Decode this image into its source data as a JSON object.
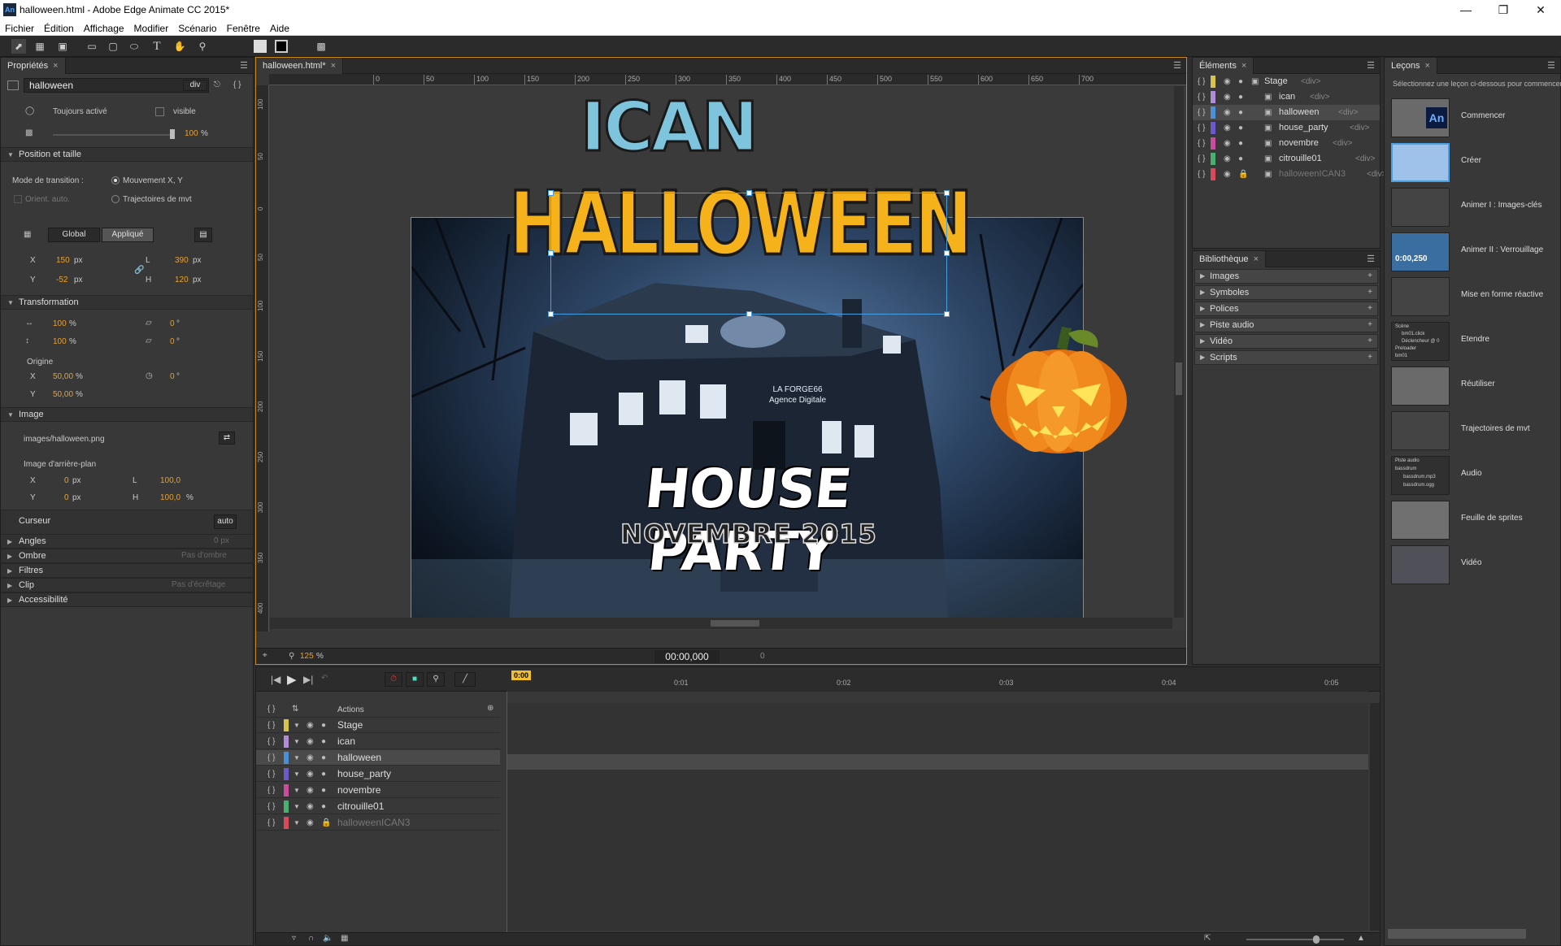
{
  "window": {
    "app_icon": "An",
    "title": "halloween.html - Adobe Edge Animate CC 2015*"
  },
  "menu": [
    "Fichier",
    "Édition",
    "Affichage",
    "Modifier",
    "Scénario",
    "Fenêtre",
    "Aide"
  ],
  "properties": {
    "tab": "Propriétés",
    "element_name": "halloween",
    "element_type": "div",
    "always_active": "Toujours activé",
    "visible": "visible",
    "opacity": "100",
    "opacity_unit": "%",
    "sec_position": "Position et taille",
    "transition_mode": "Mode de transition :",
    "mode_xy": "Mouvement X, Y",
    "orient_auto": "Orient. auto.",
    "motion_paths": "Trajectoires de mvt",
    "tab_global": "Global",
    "tab_applied": "Appliqué",
    "x_label": "X",
    "x_val": "150",
    "y_label": "Y",
    "y_val": "-52",
    "w_label": "L",
    "w_val": "390",
    "h_label": "H",
    "h_val": "120",
    "px": "px",
    "sec_transform": "Transformation",
    "scale_x": "100",
    "scale_y": "100",
    "skew_x": "0",
    "skew_y": "0",
    "deg": "°",
    "origin_label": "Origine",
    "origin_x": "50,00",
    "origin_y": "50,00",
    "rotation": "0",
    "sec_image": "Image",
    "image_path": "images/halloween.png",
    "bg_image_label": "Image d'arrière-plan",
    "bg_x": "0",
    "bg_y": "0",
    "bg_w": "100,0",
    "bg_h": "100,0",
    "cursor_label": "Curseur",
    "cursor_val": "auto",
    "angles": "Angles",
    "angles_val": "0 px",
    "shadow": "Ombre",
    "shadow_val": "Pas d'ombre",
    "filters": "Filtres",
    "clip": "Clip",
    "clip_val": "Pas d'écrêtage",
    "accessibility": "Accessibilité"
  },
  "stage": {
    "tab": "halloween.html*",
    "ruler_h": [
      "0",
      "50",
      "100",
      "150",
      "200",
      "250",
      "300",
      "350",
      "400",
      "450",
      "500",
      "550",
      "600",
      "650",
      "700"
    ],
    "ruler_v": [
      "100",
      "50",
      "0",
      "50",
      "100",
      "150",
      "200",
      "250",
      "300",
      "350",
      "400"
    ],
    "art_title1": "ICAN",
    "art_title2": "HALLOWEEN",
    "house_sign1": "LA FORGE66",
    "house_sign2": "Agence Digitale",
    "party_title": "HOUSE PARTY",
    "party_date": "NOVEMBRE 2015",
    "zoom": "125",
    "zoom_unit": "%",
    "time": "00:00,000",
    "time2": "0"
  },
  "elements_panel": {
    "tab": "Éléments",
    "items": [
      {
        "name": "Stage",
        "tag": "<div>",
        "color": "#d9c24a"
      },
      {
        "name": "ican",
        "tag": "<div>",
        "color": "#b08bd8"
      },
      {
        "name": "halloween",
        "tag": "<div>",
        "color": "#4a90d9"
      },
      {
        "name": "house_party",
        "tag": "<div>",
        "color": "#6a5acd"
      },
      {
        "name": "novembre",
        "tag": "<div>",
        "color": "#cc4aa0"
      },
      {
        "name": "citrouille01",
        "tag": "<div>",
        "color": "#4ab070"
      },
      {
        "name": "halloweenICAN3",
        "tag": "<div>",
        "color": "#d94a5a"
      }
    ]
  },
  "library": {
    "tab": "Bibliothèque",
    "items": [
      "Images",
      "Symboles",
      "Polices",
      "Piste audio",
      "Vidéo",
      "Scripts"
    ]
  },
  "lessons": {
    "tab": "Leçons",
    "hint": "Sélectionnez une leçon ci-dessous pour commencer",
    "items": [
      "Commencer",
      "Créer",
      "Animer I : Images-clés",
      "Animer II : Verrouillage",
      "Mise en forme réactive",
      "Etendre",
      "Réutiliser",
      "Trajectoires de mvt",
      "Audio",
      "Feuille de sprites",
      "Vidéo"
    ],
    "thumb_time": "0:00,250",
    "thumb_an": "An",
    "extend_lines": [
      "Scène",
      "bm01.click",
      "Déclencheur @ 0",
      "Preloader",
      "bm01"
    ],
    "audio_lines": [
      "Piste audio",
      "bassdrum",
      "bassdrum.mp3",
      "bassdrum.ogg"
    ]
  },
  "timeline": {
    "actions_label": "Actions",
    "playhead": "0:00",
    "ticks": [
      "0:01",
      "0:02",
      "0:03",
      "0:04",
      "0:05"
    ],
    "rows": [
      {
        "name": "Stage",
        "color": "#d9c24a"
      },
      {
        "name": "ican",
        "color": "#b08bd8"
      },
      {
        "name": "halloween",
        "color": "#4a90d9"
      },
      {
        "name": "house_party",
        "color": "#6a5acd"
      },
      {
        "name": "novembre",
        "color": "#cc4aa0"
      },
      {
        "name": "citrouille01",
        "color": "#4ab070"
      },
      {
        "name": "halloweenICAN3",
        "color": "#d94a5a"
      }
    ]
  },
  "colors": {
    "accent_orange": "#f0a020",
    "selection_blue": "#4a9fe0",
    "playhead_red": "#c03030"
  }
}
